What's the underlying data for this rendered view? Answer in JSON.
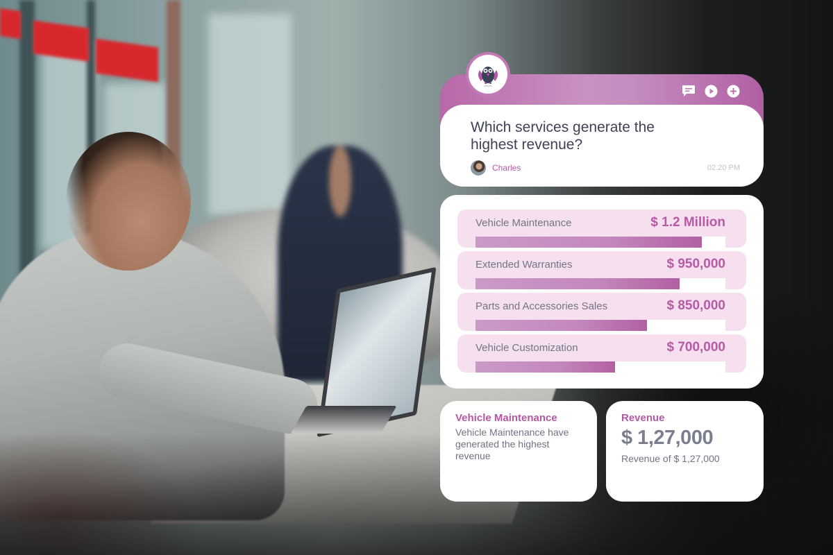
{
  "colors": {
    "accent": "#b65aa6",
    "header_gradient_start": "#b768a8",
    "header_gradient_mid": "#c992c2",
    "row_background": "#f6e0ef",
    "bar_fill_end": "#b160a3",
    "text_dark": "#3d4257",
    "text_muted": "#717485"
  },
  "question_card": {
    "logo_icon": "owl-mascot-icon",
    "actions": [
      {
        "name": "chat-icon",
        "label": "Comment"
      },
      {
        "name": "play-icon",
        "label": "Play"
      },
      {
        "name": "plus-icon",
        "label": "Add"
      }
    ],
    "question": "Which services generate the highest revenue?",
    "user": {
      "name": "Charles",
      "avatar": "user-avatar"
    },
    "time": "02.20 PM"
  },
  "revenue_list": {
    "items": [
      {
        "label": "Vehicle Maintenance",
        "value": "$ 1.2 Million",
        "progress": 0.905
      },
      {
        "label": "Extended Warranties",
        "value": "$ 950,000",
        "progress": 0.816
      },
      {
        "label": "Parts and Accessories Sales",
        "value": "$ 850,000",
        "progress": 0.685
      },
      {
        "label": "Vehicle Customization",
        "value": "$ 700,000",
        "progress": 0.557
      }
    ]
  },
  "summary_cards": {
    "top_service": {
      "title": "Vehicle Maintenance",
      "description": "Vehicle Maintenance have generated the highest revenue"
    },
    "revenue": {
      "title": "Revenue",
      "amount": "$ 1,27,000",
      "caption": "Revenue of $ 1,27,000"
    }
  }
}
